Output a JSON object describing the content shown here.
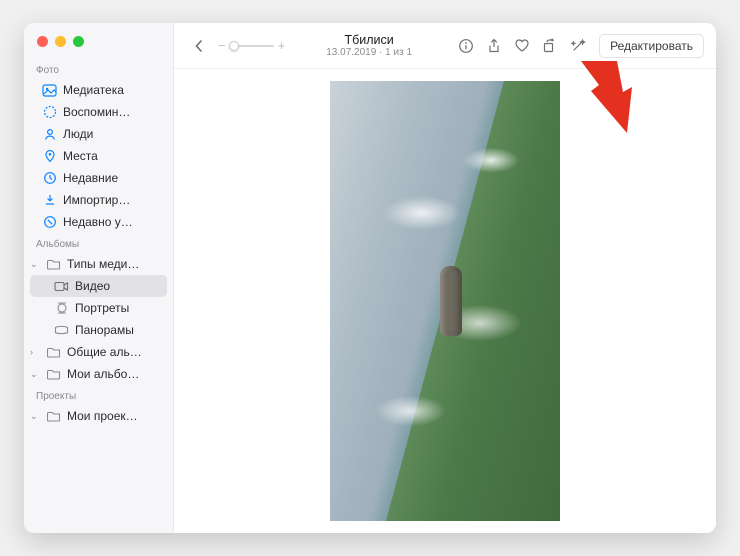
{
  "header": {
    "title": "Тбилиси",
    "subtitle": "13.07.2019 · 1 из 1",
    "edit_label": "Редактировать"
  },
  "zoom": {
    "minus": "−",
    "plus": "+"
  },
  "sidebar": {
    "sections": {
      "photos": "Фото",
      "albums": "Альбомы",
      "projects": "Проекты"
    },
    "photos_items": [
      {
        "label": "Медиатека"
      },
      {
        "label": "Воспомин…"
      },
      {
        "label": "Люди"
      },
      {
        "label": "Места"
      },
      {
        "label": "Недавние"
      },
      {
        "label": "Импортир…"
      },
      {
        "label": "Недавно у…"
      }
    ],
    "albums_items": [
      {
        "label": "Типы меди…",
        "children": [
          {
            "label": "Видео",
            "selected": true
          },
          {
            "label": "Портреты"
          },
          {
            "label": "Панорамы"
          }
        ]
      },
      {
        "label": "Общие аль…"
      },
      {
        "label": "Мои альбо…"
      }
    ],
    "projects_items": [
      {
        "label": "Мои проек…"
      }
    ]
  }
}
